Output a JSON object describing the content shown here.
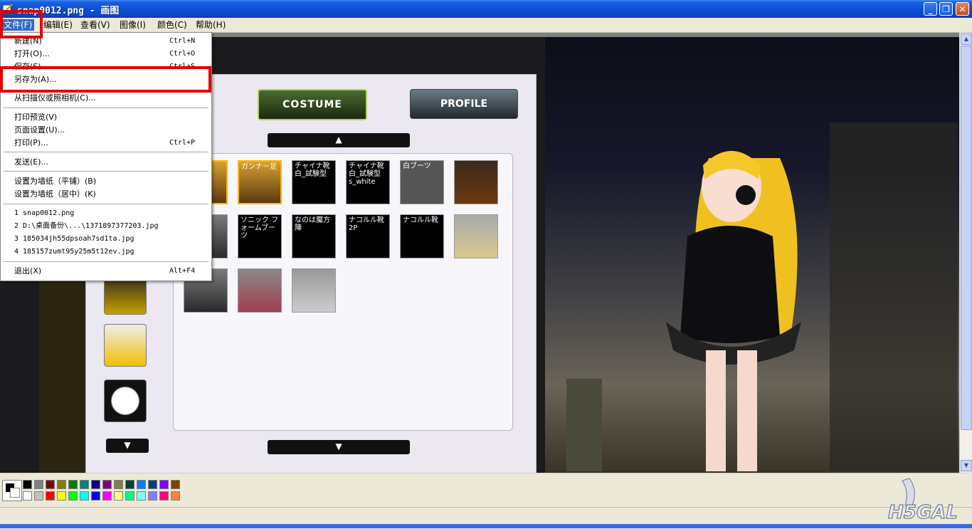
{
  "window": {
    "title": "snap0012.png - 画图",
    "minimize": "_",
    "maximize": "❐",
    "close": "✕"
  },
  "menubar": [
    "文件(F)",
    "编辑(E)",
    "查看(V)",
    "图像(I)",
    "颜色(C)",
    "帮助(H)"
  ],
  "file_menu": {
    "items": [
      {
        "label": "新建(N)",
        "shortcut": "Ctrl+N"
      },
      {
        "label": "打开(O)...",
        "shortcut": "Ctrl+O"
      },
      {
        "label": "保存(S)",
        "shortcut": "Ctrl+S"
      },
      {
        "label": "另存为(A)...",
        "shortcut": ""
      },
      {
        "label": "从扫描仪或照相机(C)...",
        "shortcut": ""
      },
      {
        "label": "打印预览(V)",
        "shortcut": ""
      },
      {
        "label": "页面设置(U)...",
        "shortcut": ""
      },
      {
        "label": "打印(P)...",
        "shortcut": "Ctrl+P"
      },
      {
        "label": "发送(E)...",
        "shortcut": ""
      },
      {
        "label": "设置为墙纸（平铺）(B)",
        "shortcut": ""
      },
      {
        "label": "设置为墙纸（居中）(K)",
        "shortcut": ""
      },
      {
        "label": "退出(X)",
        "shortcut": "Alt+F4"
      }
    ],
    "recent": [
      "1 snap0012.png",
      "2 D:\\桌面备份\\...\\1371897377203.jpg",
      "3 185034jh55dpsoah7sd1ta.jpg",
      "4 185157zumt95y25m5t12ev.jpg"
    ]
  },
  "game": {
    "costume_button": "COSTUME",
    "profile_button": "PROFILE",
    "up_arrow": "▲",
    "down_arrow": "▼",
    "items_row1": [
      "足",
      "ガンナー足",
      "チャイナ靴 白_試験型",
      "チャイナ靴 白_試験型 s_white",
      "白ブーツ",
      ""
    ],
    "items_row2": [
      "",
      "ソニック フォームブーツ",
      "なのは魔方陣",
      "ナコルル靴 2P",
      "ナコルル靴",
      ""
    ]
  },
  "colors": {
    "highlight_box": "#e00000",
    "menu_selection": "#316ac5",
    "palette": [
      "#000000",
      "#808080",
      "#800000",
      "#808000",
      "#008000",
      "#008080",
      "#000080",
      "#800080",
      "#808040",
      "#004040",
      "#0080ff",
      "#004080",
      "#8000ff",
      "#804000",
      "#ffffff",
      "#c0c0c0",
      "#ff0000",
      "#ffff00",
      "#00ff00",
      "#00ffff",
      "#0000ff",
      "#ff00ff",
      "#ffff80",
      "#00ff80",
      "#80ffff",
      "#8080ff",
      "#ff0080",
      "#ff8040"
    ]
  },
  "watermark": "H5GAL"
}
